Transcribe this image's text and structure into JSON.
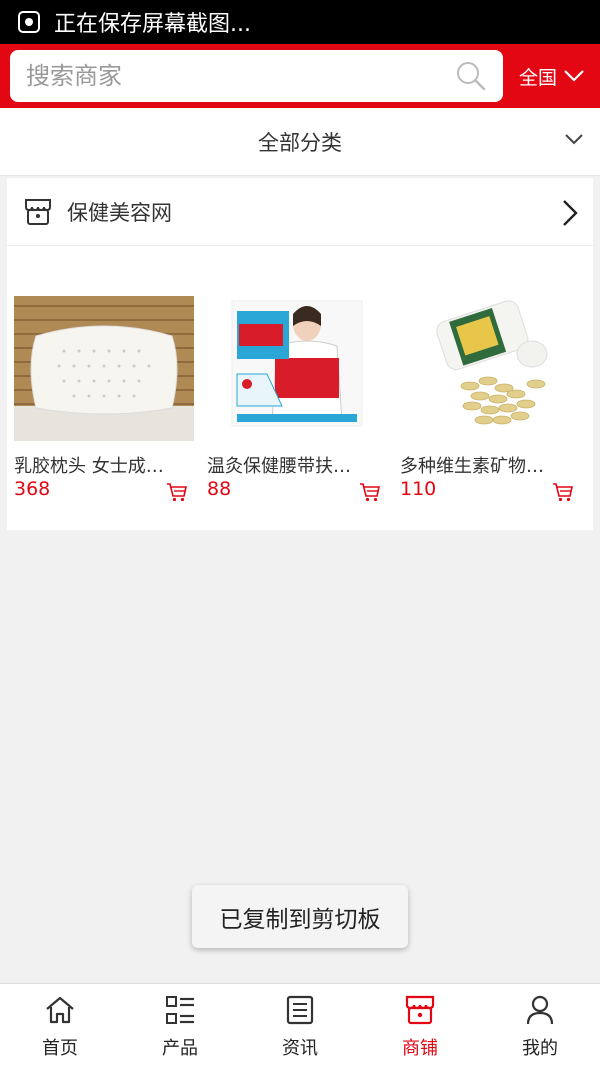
{
  "status_bar": {
    "text": "正在保存屏幕截图..."
  },
  "header": {
    "search_placeholder": "搜索商家",
    "region_label": "全国"
  },
  "category": {
    "label": "全部分类"
  },
  "store": {
    "name": "保健美容网",
    "products": [
      {
        "name": "乳胶枕头 女士成…",
        "price": "368"
      },
      {
        "name": "温灸保健腰带扶…",
        "price": "88"
      },
      {
        "name": "多种维生素矿物…",
        "price": "110"
      }
    ]
  },
  "toast": {
    "text": "已复制到剪切板"
  },
  "tabs": [
    {
      "label": "首页",
      "icon": "home-icon",
      "active": false
    },
    {
      "label": "产品",
      "icon": "product-list-icon",
      "active": false
    },
    {
      "label": "资讯",
      "icon": "news-icon",
      "active": false
    },
    {
      "label": "商铺",
      "icon": "store-icon",
      "active": true
    },
    {
      "label": "我的",
      "icon": "user-icon",
      "active": false
    }
  ],
  "colors": {
    "accent": "#e30613",
    "background": "#f1f1f1"
  }
}
